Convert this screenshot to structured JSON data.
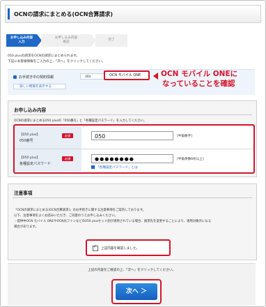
{
  "header": {
    "title": "OCNの請求にまとめる(OCN合算請求)"
  },
  "steps": [
    {
      "label": "お申し込み内容\n入力"
    },
    {
      "label": "お申し込み内容\n確認"
    },
    {
      "label": "完了"
    }
  ],
  "intro": {
    "line1": "050 plusの請求をOCNの請求にまとめられます。",
    "line2": "下記にお客様情報をご入力の上、「次へ」をクリックしてください。"
  },
  "contract": {
    "label": "お手続き中の契約情報",
    "pill": "(ID)",
    "selected": "OCN モバイル ONE",
    "more_link": "詳しい情報を表示する"
  },
  "annotation": {
    "line1": "OCN モバイル ONEに",
    "line2": "なっていることを確認"
  },
  "application": {
    "title": "お申し込み内容",
    "desc": "OCNの請求にまとめる050 plusの「050番号」と「各種設定パスワード」を入力してください。",
    "required_badge": "必須",
    "number_field": {
      "label_top": "【050 plus】",
      "label_main": "050番号",
      "value": "050",
      "hint": "[半角数字]"
    },
    "password_field": {
      "label_top": "【050 plus】",
      "label_main": "各種設定パスワード",
      "value": "●●●●●●●●",
      "hint": "[半角英数6桁以上]",
      "link": "「各種設定パスワード」とは"
    }
  },
  "notes": {
    "title": "注意事項",
    "lines": [
      "「OCNの請求にまとめる(OCN合算請求)」のお手続きに関する注意事項をご案内しております。",
      "以下、注意事項をよくお読みいただき、ご同意のうえお申し込みください。",
      "・提供中OCN モバイル ONEやOCN光ファンなどの050 plusセット割が適用されている場合、請求先を変更することにより、適用対象外になる",
      "場合があります。"
    ],
    "agree_label": "上記内容を確認しました。"
  },
  "footer": {
    "message": "上記の内容をご確認の上、「次へ」をクリックしてください。",
    "next_button": "次へ ＞"
  }
}
